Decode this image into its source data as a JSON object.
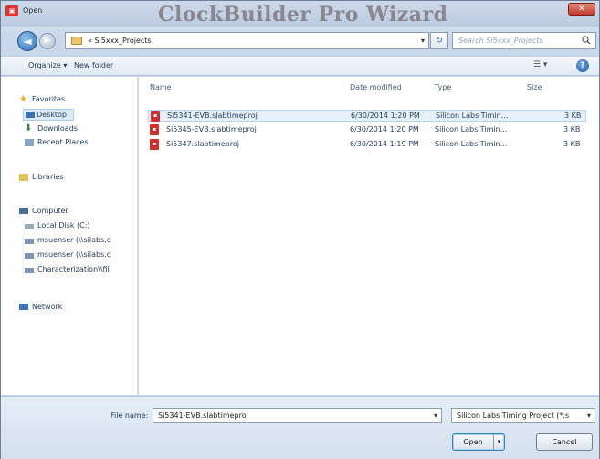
{
  "window": {
    "title": "Open",
    "ghost_title": "ClockBuilder Pro Wizard"
  },
  "address": {
    "path": "« Si5xxx_Projects",
    "search_placeholder": "Search Si5xxx_Projects"
  },
  "toolbar": {
    "organize": "Organize ▾",
    "new_folder": "New folder"
  },
  "sidebar": {
    "favorites": "Favorites",
    "desktop": "Desktop",
    "downloads": "Downloads",
    "recent": "Recent Places",
    "libraries": "Libraries",
    "computer": "Computer",
    "local_disk": "Local Disk (C:)",
    "net1": "msuenser (\\\\silabs.c",
    "net2": "msuenser (\\\\silabs.c",
    "net3": "Characterization\\\\fil",
    "network": "Network"
  },
  "columns": {
    "name": "Name",
    "date": "Date modified",
    "type": "Type",
    "size": "Size"
  },
  "files": [
    {
      "name": "Si5341-EVB.slabtimeproj",
      "date": "6/30/2014 1:20 PM",
      "type": "Silicon Labs Timin...",
      "size": "3 KB"
    },
    {
      "name": "Si5345-EVB.slabtimeproj",
      "date": "6/30/2014 1:20 PM",
      "type": "Silicon Labs Timin...",
      "size": "3 KB"
    },
    {
      "name": "Si5347.slabtimeproj",
      "date": "6/30/2014 1:19 PM",
      "type": "Silicon Labs Timin...",
      "size": "3 KB"
    }
  ],
  "bottom": {
    "filename_label": "File name:",
    "filename_value": "Si5341-EVB.slabtimeproj",
    "filetype": "Silicon Labs Timing Project (*.s",
    "open": "Open",
    "cancel": "Cancel"
  }
}
